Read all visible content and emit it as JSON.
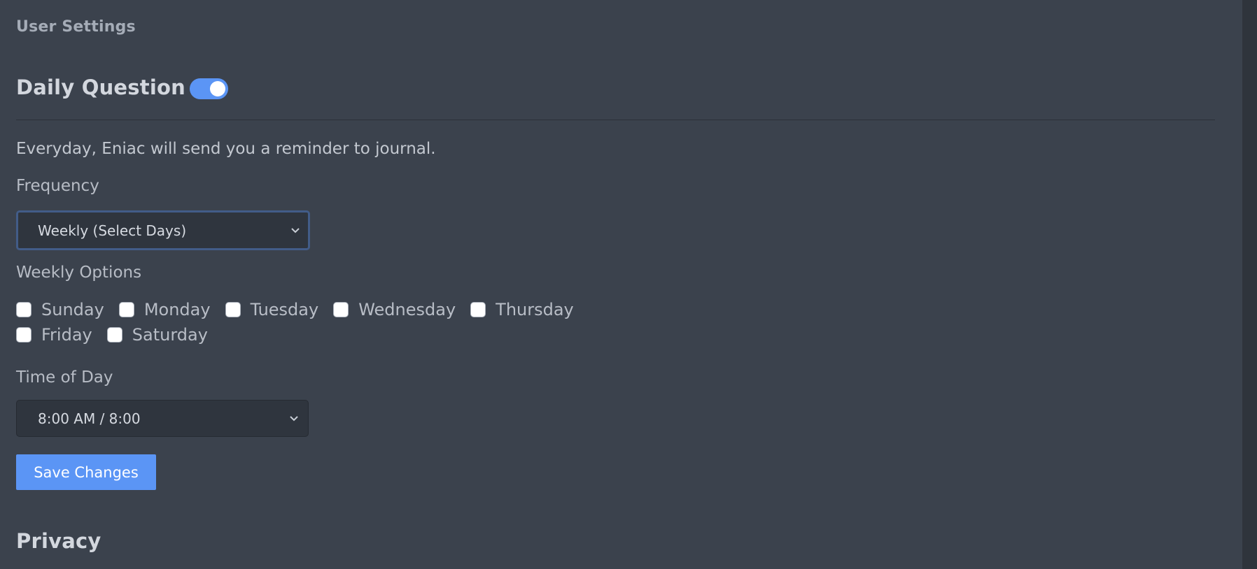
{
  "header": {
    "title": "User Settings"
  },
  "daily_question": {
    "title": "Daily Question",
    "enabled": true,
    "description": "Everyday, Eniac will send you a reminder to journal.",
    "frequency": {
      "label": "Frequency",
      "selected": "Weekly (Select Days)"
    },
    "weekly_options": {
      "label": "Weekly Options",
      "days": [
        {
          "label": "Sunday",
          "checked": false
        },
        {
          "label": "Monday",
          "checked": false
        },
        {
          "label": "Tuesday",
          "checked": false
        },
        {
          "label": "Wednesday",
          "checked": false
        },
        {
          "label": "Thursday",
          "checked": false
        },
        {
          "label": "Friday",
          "checked": false
        },
        {
          "label": "Saturday",
          "checked": false
        }
      ]
    },
    "time_of_day": {
      "label": "Time of Day",
      "selected": "8:00 AM / 8:00"
    },
    "save_label": "Save Changes"
  },
  "privacy": {
    "title": "Privacy"
  },
  "colors": {
    "background": "#3b424d",
    "accent": "#5b95f5",
    "input_bg": "#2f353e"
  },
  "icons": {
    "toggle": "toggle-switch",
    "dropdown": "chevron-down-icon",
    "checkbox": "checkbox"
  }
}
